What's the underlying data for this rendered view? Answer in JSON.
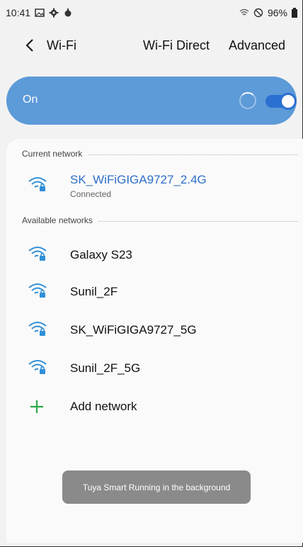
{
  "status_bar": {
    "time": "10:41",
    "battery_percent": "96%",
    "left_icons": [
      "gallery-icon",
      "settings-icon",
      "notification-icon"
    ],
    "right_icons": [
      "wifi-icon",
      "dnd-icon",
      "battery-icon"
    ]
  },
  "header": {
    "back_label": "<",
    "title": "Wi-Fi",
    "wifi_direct": "Wi-Fi Direct",
    "advanced": "Advanced"
  },
  "toggle_card": {
    "label": "On",
    "state": true,
    "accent_color": "#5c9ad8"
  },
  "current_network": {
    "section_label": "Current network",
    "name": "SK_WiFiGIGA9727_2.4G",
    "status": "Connected"
  },
  "available_networks": {
    "section_label": "Available networks",
    "items": [
      {
        "name": "Galaxy S23"
      },
      {
        "name": "Sunil_2F"
      },
      {
        "name": "SK_WiFiGIGA9727_5G"
      },
      {
        "name": "Sunil_2F_5G"
      }
    ]
  },
  "add_network": {
    "label": "Add network"
  },
  "toast": {
    "text": "Tuya Smart Running in the background"
  }
}
